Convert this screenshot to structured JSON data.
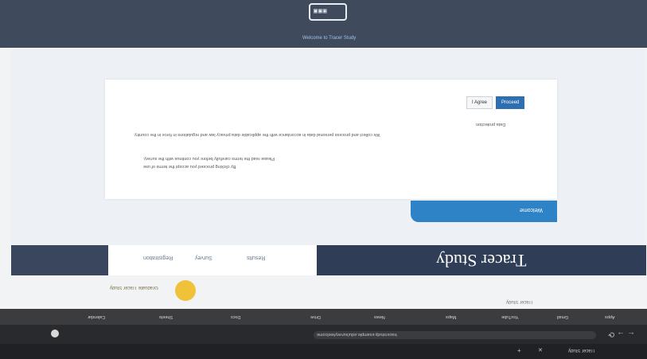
{
  "header": {
    "link": "Welcome to Tracer Study"
  },
  "notice_card": {
    "buttons": [
      "I Agree",
      "Proceed"
    ],
    "lines": [
      "Data protection",
      "We collect and process personal data in accordance with the applicable data privacy law and regulations in force in the country.",
      "Please read the terms carefully before you continue with the survey.",
      "By clicking proceed you accept the terms of use"
    ]
  },
  "blue_tab": {
    "label": "Welcome"
  },
  "nav": {
    "title": "Tracer Study",
    "items": [
      "Registration",
      "Survey",
      "Results"
    ]
  },
  "footer": {
    "left_text": "Graduate Tracer Study",
    "right_text": "Tracer Study"
  },
  "browser": {
    "url": "tracerstudy.example.edu/survey/welcome",
    "tab_title": "Tracer Study",
    "bookmarks": [
      "Apps",
      "Gmail",
      "YouTube",
      "Maps",
      "News",
      "Drive",
      "Docs",
      "Sheets",
      "Calendar"
    ]
  }
}
